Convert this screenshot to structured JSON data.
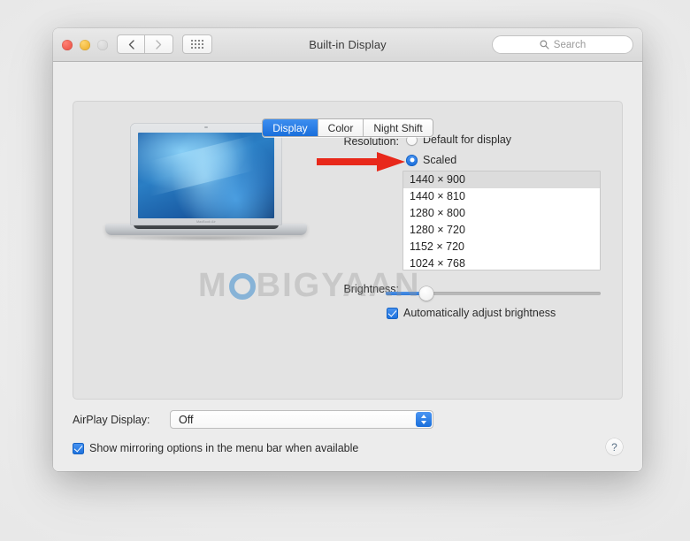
{
  "window": {
    "title": "Built-in Display",
    "traffic_lights": [
      "close",
      "minimize",
      "zoom"
    ],
    "nav": {
      "back": "back-arrow",
      "forward": "forward-arrow",
      "show_all": "grid-icon"
    },
    "search": {
      "placeholder": "Search",
      "value": "",
      "icon": "search-icon"
    }
  },
  "tabs": [
    {
      "label": "Display",
      "active": true
    },
    {
      "label": "Color",
      "active": false
    },
    {
      "label": "Night Shift",
      "active": false
    }
  ],
  "preview": {
    "device": "MacBook Air",
    "brand_text": "MacBook Air"
  },
  "watermark": {
    "before": "M",
    "circle": "O",
    "after": "BIGYAAN"
  },
  "resolution": {
    "label": "Resolution:",
    "options": [
      {
        "label": "Default for display",
        "selected": false
      },
      {
        "label": "Scaled",
        "selected": true
      }
    ],
    "list": [
      {
        "label": "1440 × 900",
        "selected": true
      },
      {
        "label": "1440 × 810",
        "selected": false
      },
      {
        "label": "1280 × 800",
        "selected": false
      },
      {
        "label": "1280 × 720",
        "selected": false
      },
      {
        "label": "1152 × 720",
        "selected": false
      },
      {
        "label": "1024 × 768",
        "selected": false
      }
    ]
  },
  "brightness": {
    "label": "Brightness:",
    "value_percent": 19,
    "auto_adjust": {
      "label": "Automatically adjust brightness",
      "checked": true
    }
  },
  "airplay": {
    "label": "AirPlay Display:",
    "value": "Off",
    "options": [
      "Off"
    ]
  },
  "mirroring": {
    "label": "Show mirroring options in the menu bar when available",
    "checked": true
  },
  "help": {
    "glyph": "?"
  },
  "annotation": {
    "type": "red-arrow",
    "points_at": "Scaled",
    "color": "#e8281a"
  },
  "colors": {
    "accent": "#1a6fdb",
    "window_bg": "#ececec",
    "panel_bg": "#e3e3e3",
    "list_selected": "#dcdcdc",
    "arrow_red": "#e8281a"
  }
}
